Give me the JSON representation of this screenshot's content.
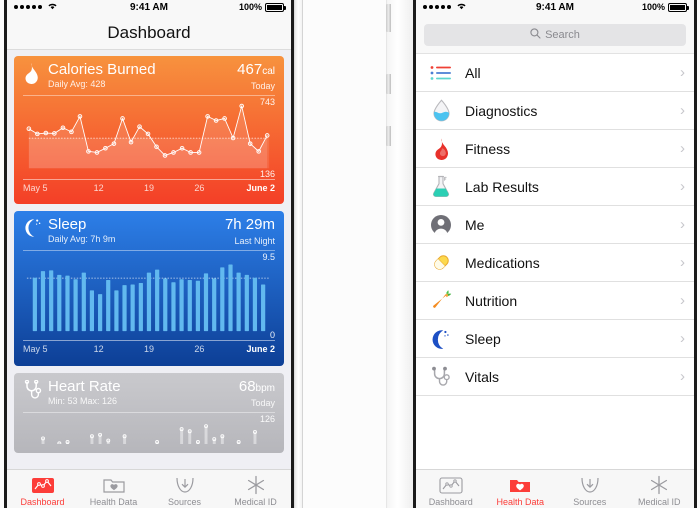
{
  "status_bar": {
    "signal_dots": 5,
    "wifi_icon": "wifi-icon",
    "time": "9:41 AM",
    "battery_pct": "100%"
  },
  "left_phone": {
    "nav_title": "Dashboard",
    "cards": [
      {
        "id": "calories",
        "icon": "flame-icon",
        "title": "Calories Burned",
        "subtitle": "Daily Avg: 428",
        "value": "467",
        "value_unit": "cal",
        "value_caption": "Today",
        "y_max": "743",
        "y_min": "136",
        "x_labels": [
          "May 5",
          "12",
          "19",
          "26",
          "June 2"
        ],
        "accent": "#f5762f"
      },
      {
        "id": "sleep",
        "icon": "moon-icon",
        "title": "Sleep",
        "subtitle": "Daily Avg: 7h 9m",
        "value": "7h 29m",
        "value_unit": "",
        "value_caption": "Last Night",
        "y_max": "9.5",
        "y_min": "0",
        "x_labels": [
          "May 5",
          "12",
          "19",
          "26",
          "June 2"
        ],
        "accent": "#1f6fd8"
      },
      {
        "id": "heart-rate",
        "icon": "stethoscope-icon",
        "title": "Heart Rate",
        "subtitle": "Min: 53 Max: 126",
        "value": "68",
        "value_unit": "bpm",
        "value_caption": "Today",
        "y_max": "126",
        "y_min": "",
        "x_labels": [],
        "accent": "#b9b9be"
      }
    ],
    "tabs": [
      {
        "label": "Dashboard",
        "icon": "dashboard-chart-icon",
        "active": true
      },
      {
        "label": "Health Data",
        "icon": "folder-heart-icon",
        "active": false
      },
      {
        "label": "Sources",
        "icon": "download-arrow-icon",
        "active": false
      },
      {
        "label": "Medical ID",
        "icon": "medical-star-icon",
        "active": false
      }
    ]
  },
  "right_phone": {
    "search": {
      "placeholder": "Search",
      "value": "",
      "icon": "search-icon"
    },
    "list_items": [
      {
        "label": "All",
        "icon": "list-lines-icon",
        "chevron": "›"
      },
      {
        "label": "Diagnostics",
        "icon": "water-drop-icon",
        "chevron": "›"
      },
      {
        "label": "Fitness",
        "icon": "flame-icon",
        "chevron": "›"
      },
      {
        "label": "Lab Results",
        "icon": "flask-icon",
        "chevron": "›"
      },
      {
        "label": "Me",
        "icon": "person-icon",
        "chevron": "›"
      },
      {
        "label": "Medications",
        "icon": "pill-icon",
        "chevron": "›"
      },
      {
        "label": "Nutrition",
        "icon": "carrot-icon",
        "chevron": "›"
      },
      {
        "label": "Sleep",
        "icon": "moon-icon",
        "chevron": "›"
      },
      {
        "label": "Vitals",
        "icon": "stethoscope-icon",
        "chevron": "›"
      }
    ],
    "tabs": [
      {
        "label": "Dashboard",
        "icon": "dashboard-chart-icon",
        "active": false
      },
      {
        "label": "Health Data",
        "icon": "folder-heart-icon",
        "active": true
      },
      {
        "label": "Sources",
        "icon": "download-arrow-icon",
        "active": false
      },
      {
        "label": "Medical ID",
        "icon": "medical-star-icon",
        "active": false
      }
    ]
  },
  "chart_data": [
    {
      "type": "line",
      "id": "calories-burned",
      "title": "Calories Burned",
      "ylabel": "cal",
      "ylim": [
        136,
        743
      ],
      "grid": false,
      "average_line": 428,
      "xlabel": "",
      "x_tick_labels": [
        "May 5",
        "12",
        "19",
        "26",
        "June 2"
      ],
      "x": [
        1,
        2,
        3,
        4,
        5,
        6,
        7,
        8,
        9,
        10,
        11,
        12,
        13,
        14,
        15,
        16,
        17,
        18,
        19,
        20,
        21,
        22,
        23,
        24,
        25,
        26,
        27,
        28,
        29
      ],
      "values": [
        520,
        470,
        478,
        475,
        530,
        490,
        640,
        300,
        290,
        330,
        375,
        620,
        390,
        540,
        470,
        345,
        260,
        290,
        330,
        290,
        290,
        640,
        600,
        620,
        430,
        740,
        375,
        300,
        455
      ]
    },
    {
      "type": "bar",
      "id": "sleep",
      "title": "Sleep",
      "ylabel": "hours",
      "ylim": [
        0,
        9.5
      ],
      "grid": false,
      "average_line": 7.15,
      "xlabel": "",
      "x_tick_labels": [
        "May 5",
        "12",
        "19",
        "26",
        "June 2"
      ],
      "categories": [
        1,
        2,
        3,
        4,
        5,
        6,
        7,
        8,
        9,
        10,
        11,
        12,
        13,
        14,
        15,
        16,
        17,
        18,
        19,
        20,
        21,
        22,
        23,
        24,
        25,
        26,
        27,
        28,
        29
      ],
      "values": [
        7.2,
        8.1,
        8.2,
        7.6,
        7.5,
        7.0,
        7.9,
        5.5,
        5.0,
        6.9,
        5.5,
        6.2,
        6.3,
        6.5,
        7.9,
        8.3,
        7.1,
        6.6,
        7.0,
        6.9,
        6.8,
        7.8,
        7.1,
        8.6,
        9.0,
        7.9,
        7.6,
        7.2,
        6.3
      ]
    },
    {
      "type": "bar",
      "id": "heart-rate",
      "title": "Heart Rate",
      "ylabel": "bpm",
      "ylim": [
        53,
        126
      ],
      "grid": false,
      "xlabel": "",
      "categories": [
        1,
        2,
        3,
        4,
        5,
        6,
        7,
        8,
        9,
        10,
        11,
        12,
        13,
        14,
        15,
        16,
        17,
        18,
        19,
        20,
        21,
        22,
        23,
        24,
        25,
        26,
        27,
        28,
        29
      ],
      "values": [
        62,
        75,
        60,
        68,
        70,
        62,
        58,
        78,
        80,
        72,
        66,
        78,
        60,
        58,
        66,
        70,
        62,
        64,
        88,
        85,
        70,
        92,
        74,
        78,
        62,
        70,
        66,
        84,
        60
      ]
    }
  ]
}
